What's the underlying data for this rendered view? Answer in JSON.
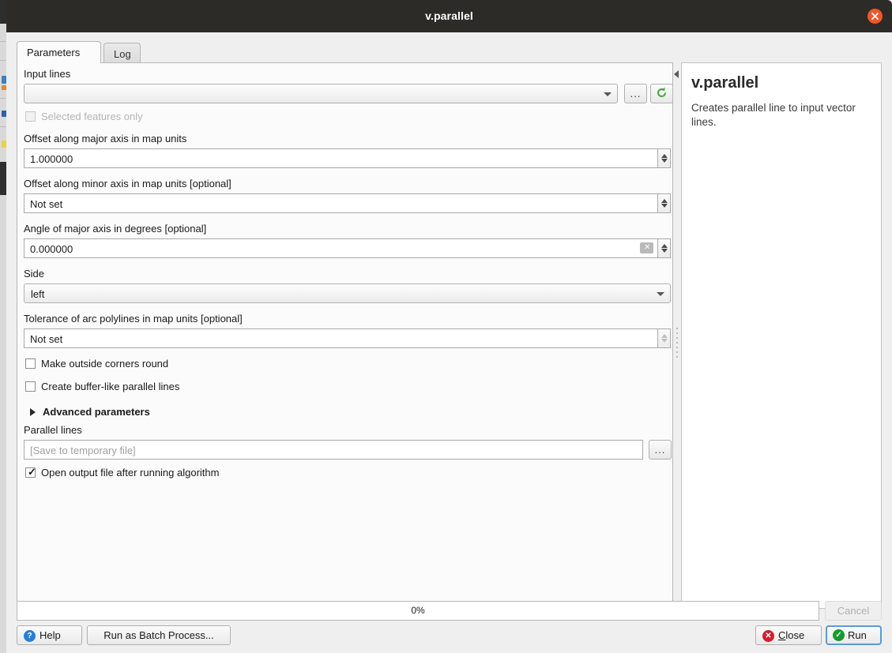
{
  "window": {
    "title": "v.parallel",
    "close_icon": "close-icon"
  },
  "tabs": [
    {
      "label": "Parameters",
      "selected": true
    },
    {
      "label": "Log",
      "selected": false
    }
  ],
  "parameters": {
    "input_lines": {
      "label": "Input lines",
      "value": "",
      "browse_label": "...",
      "iterate_icon": "iterate-refresh-icon"
    },
    "selected_features_only": {
      "label": "Selected features only",
      "checked": false,
      "enabled": false
    },
    "offset_major": {
      "label": "Offset along major axis in map units",
      "value": "1.000000"
    },
    "offset_minor": {
      "label": "Offset along minor axis in map units [optional]",
      "value": "Not set"
    },
    "angle_major": {
      "label": "Angle of major axis in degrees [optional]",
      "value": "0.000000",
      "clear_icon": "clear-field-icon"
    },
    "side": {
      "label": "Side",
      "value": "left"
    },
    "tolerance": {
      "label": "Tolerance of arc polylines in map units [optional]",
      "value": "Not set"
    },
    "make_outside_corners_round": {
      "label": "Make outside corners round",
      "checked": false
    },
    "create_buffer_like": {
      "label": "Create buffer-like parallel lines",
      "checked": false
    },
    "advanced": {
      "label": "Advanced parameters",
      "expanded": false
    },
    "parallel_lines_output": {
      "label": "Parallel lines",
      "value": "",
      "placeholder": "[Save to temporary file]",
      "browse_label": "..."
    },
    "open_output": {
      "label": "Open output file after running algorithm",
      "checked": true
    }
  },
  "description": {
    "title": "v.parallel",
    "text": "Creates parallel line to input vector lines."
  },
  "progress": {
    "percent_label": "0%",
    "cancel_label": "Cancel"
  },
  "buttons": {
    "help": "Help",
    "batch": "Run as Batch Process...",
    "close_prefix": "C",
    "close_rest": "lose",
    "run": "Run"
  },
  "colors": {
    "titlebar": "#2d2b28",
    "close_button": "#ef5828",
    "panel_bg": "#efefef",
    "field_bg": "#ffffff",
    "help_icon": "#2a7fd4",
    "close_icon": "#cf1f2e",
    "run_icon": "#169a2e",
    "focus_border": "#5b9bd5"
  }
}
